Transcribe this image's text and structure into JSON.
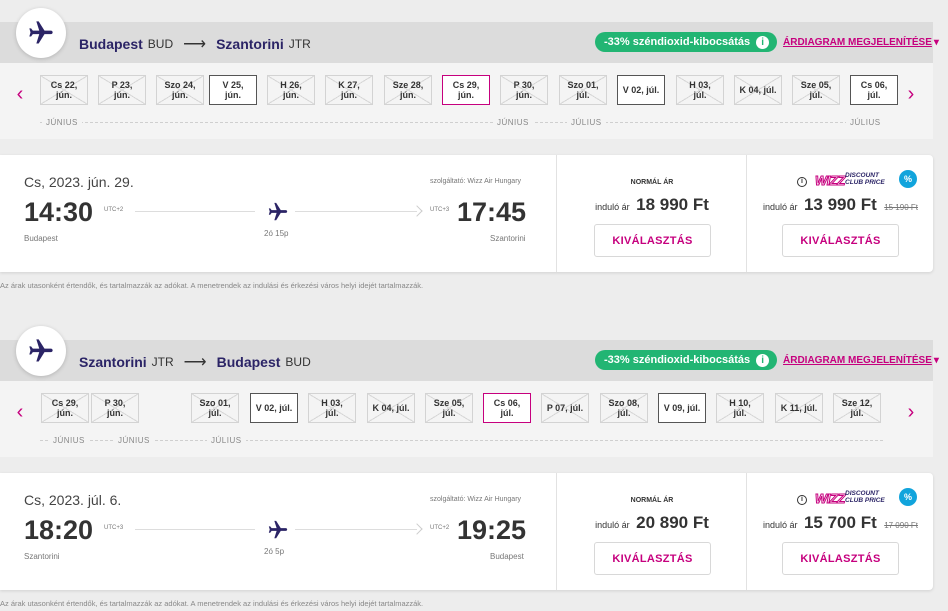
{
  "segments": [
    {
      "origin_city": "Budapest",
      "origin_code": "BUD",
      "dest_city": "Szantorini",
      "dest_code": "JTR",
      "co2_badge": "-33% széndioxid-kibocsátás",
      "price_chart_link": "ÁRDIAGRAM MEGJELENÍTÉSE",
      "dates": [
        {
          "l1": "Cs 22,",
          "l2": "jún.",
          "state": "unavailable"
        },
        {
          "l1": "P 23,",
          "l2": "jún.",
          "state": "unavailable"
        },
        {
          "l1": "Szo 24,",
          "l2": "jún.",
          "state": "unavailable"
        },
        {
          "l1": "V 25,",
          "l2": "jún.",
          "state": "available"
        },
        {
          "l1": "H 26,",
          "l2": "jún.",
          "state": "unavailable"
        },
        {
          "l1": "K 27,",
          "l2": "jún.",
          "state": "unavailable"
        },
        {
          "l1": "Sze 28,",
          "l2": "jún.",
          "state": "unavailable"
        },
        {
          "l1": "Cs 29,",
          "l2": "jún.",
          "state": "selected"
        },
        {
          "l1": "P 30,",
          "l2": "jún.",
          "state": "unavailable"
        },
        {
          "l1": "Szo 01,",
          "l2": "júl.",
          "state": "unavailable"
        },
        {
          "l1": "V 02, júl.",
          "l2": "",
          "state": "available"
        },
        {
          "l1": "H 03,",
          "l2": "júl.",
          "state": "unavailable"
        },
        {
          "l1": "K 04, júl.",
          "l2": "",
          "state": "unavailable"
        },
        {
          "l1": "Sze 05,",
          "l2": "júl.",
          "state": "unavailable"
        },
        {
          "l1": "Cs 06,",
          "l2": "júl.",
          "state": "available"
        }
      ],
      "months": [
        "JÚNIUS",
        "JÚNIUS",
        "JÚLIUS",
        "JÚLIUS"
      ],
      "flight": {
        "date": "Cs, 2023. jún. 29.",
        "operator": "szolgáltató: Wizz Air Hungary",
        "dep_time": "14:30",
        "dep_utc": "UTC+2",
        "arr_time": "17:45",
        "arr_utc": "UTC+3",
        "duration": "2ó 15p",
        "from": "Budapest",
        "to": "Szantorini"
      },
      "normal_price": {
        "title": "NORMÁL ÁR",
        "from_label": "induló ár",
        "amount": "18 990 Ft",
        "button": "KIVÁLASZTÁS"
      },
      "club_price": {
        "logo_wizz": "WIZZ",
        "logo_sub1": "DISCOUNT",
        "logo_sub2": "CLUB PRICE",
        "badge": "%",
        "from_label": "induló ár",
        "amount": "13 990 Ft",
        "old_amount": "15 190 Ft",
        "button": "KIVÁLASZTÁS"
      }
    },
    {
      "origin_city": "Szantorini",
      "origin_code": "JTR",
      "dest_city": "Budapest",
      "dest_code": "BUD",
      "co2_badge": "-33% széndioxid-kibocsátás",
      "price_chart_link": "ÁRDIAGRAM MEGJELENÍTÉSE",
      "dates": [
        {
          "l1": "Cs 29,",
          "l2": "jún.",
          "state": "unavailable"
        },
        {
          "l1": "P 30,",
          "l2": "jún.",
          "state": "unavailable"
        },
        {
          "l1": "Szo 01,",
          "l2": "júl.",
          "state": "unavailable"
        },
        {
          "l1": "V 02, júl.",
          "l2": "",
          "state": "available"
        },
        {
          "l1": "H 03,",
          "l2": "júl.",
          "state": "unavailable"
        },
        {
          "l1": "K 04, júl.",
          "l2": "",
          "state": "unavailable"
        },
        {
          "l1": "Sze 05,",
          "l2": "júl.",
          "state": "unavailable"
        },
        {
          "l1": "Cs 06,",
          "l2": "júl.",
          "state": "selected"
        },
        {
          "l1": "P 07, júl.",
          "l2": "",
          "state": "unavailable"
        },
        {
          "l1": "Szo 08,",
          "l2": "júl.",
          "state": "unavailable"
        },
        {
          "l1": "V 09, júl.",
          "l2": "",
          "state": "available"
        },
        {
          "l1": "H 10,",
          "l2": "júl.",
          "state": "unavailable"
        },
        {
          "l1": "K 11, júl.",
          "l2": "",
          "state": "unavailable"
        },
        {
          "l1": "Sze 12,",
          "l2": "júl.",
          "state": "unavailable"
        }
      ],
      "months": [
        "JÚNIUS",
        "JÚNIUS",
        "JÚLIUS"
      ],
      "flight": {
        "date": "Cs, 2023. júl. 6.",
        "operator": "szolgáltató: Wizz Air Hungary",
        "dep_time": "18:20",
        "dep_utc": "UTC+3",
        "arr_time": "19:25",
        "arr_utc": "UTC+2",
        "duration": "2ó 5p",
        "from": "Szantorini",
        "to": "Budapest"
      },
      "normal_price": {
        "title": "NORMÁL ÁR",
        "from_label": "induló ár",
        "amount": "20 890 Ft",
        "button": "KIVÁLASZTÁS"
      },
      "club_price": {
        "logo_wizz": "WIZZ",
        "logo_sub1": "DISCOUNT",
        "logo_sub2": "CLUB PRICE",
        "badge": "%",
        "from_label": "induló ár",
        "amount": "15 700 Ft",
        "old_amount": "17 090 Ft",
        "button": "KIVÁLASZTÁS"
      }
    }
  ],
  "disclaimer": "Az árak utasonként értendők, és tartalmazzák az adókat. A menetrendek az indulási és érkezési város helyi idejét tartalmazzák.",
  "colors": {
    "brand_magenta": "#c6007e",
    "brand_navy": "#2b2466",
    "co2_green": "#22b573",
    "club_blue": "#11a4dc"
  },
  "icons": {
    "plane": "plane-icon",
    "prev": "chevron-left-icon",
    "next": "chevron-right-icon",
    "info": "info-icon"
  }
}
